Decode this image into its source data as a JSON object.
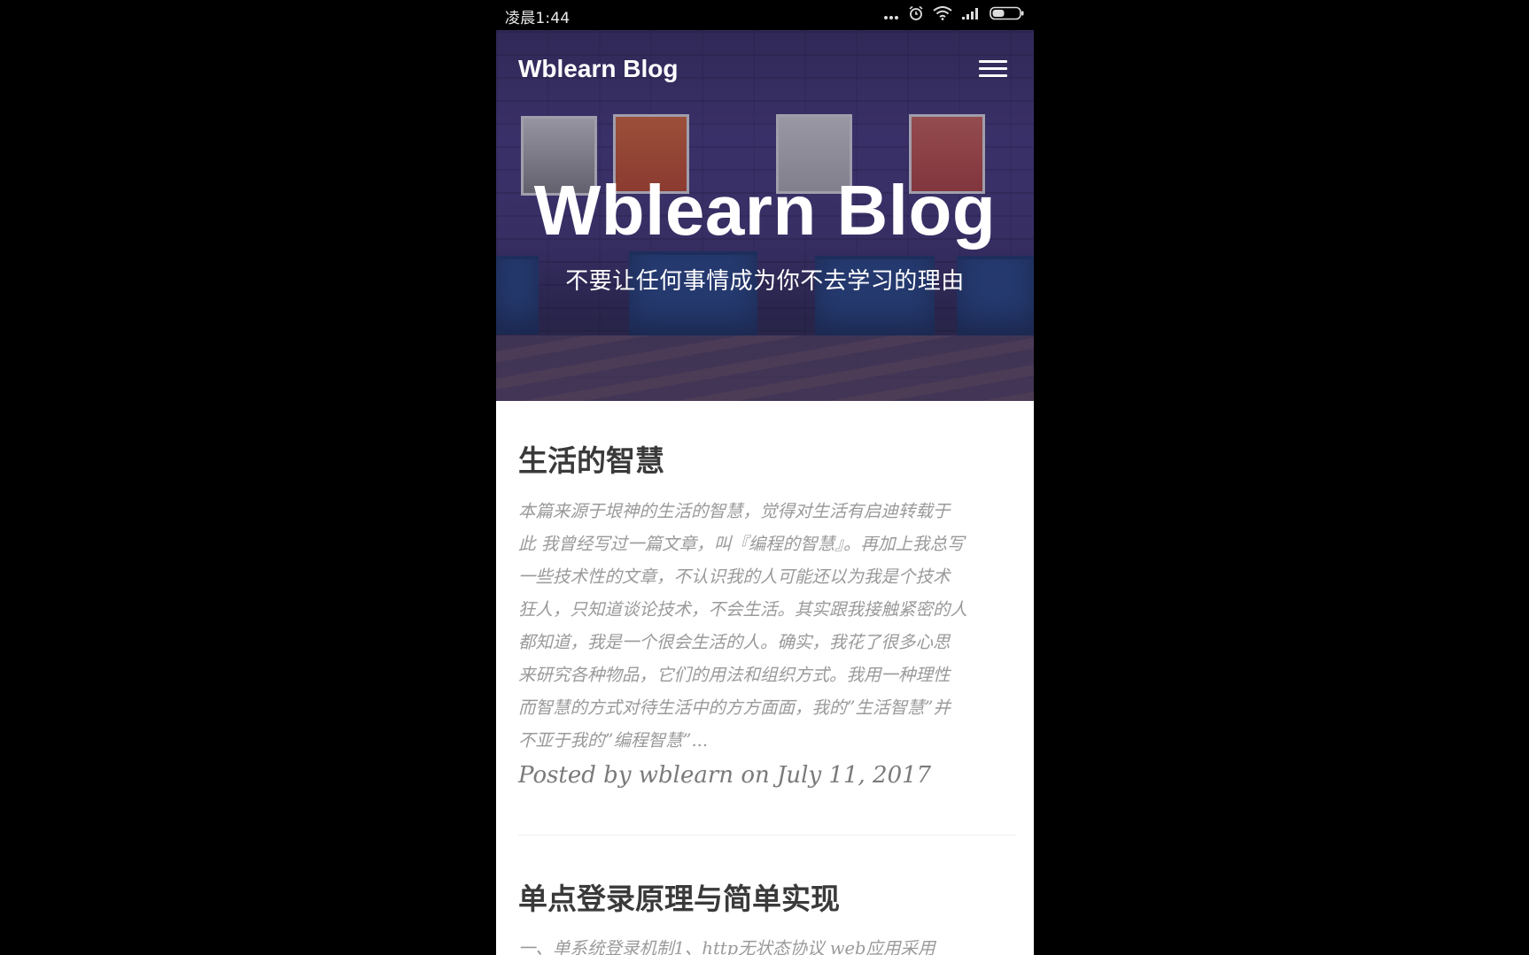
{
  "status_bar": {
    "time": "凌晨1:44",
    "icons": [
      "more-dots-icon",
      "alarm-icon",
      "wifi-icon",
      "signal-icon",
      "battery-icon"
    ]
  },
  "navbar": {
    "brand": "Wblearn Blog",
    "menu_icon": "hamburger-menu-icon"
  },
  "hero": {
    "title": "Wblearn Blog",
    "subtitle": "不要让任何事情成为你不去学习的理由"
  },
  "posts": [
    {
      "title": "生活的智慧",
      "excerpt_lines": [
        "本篇来源于垠神的生活的智慧，觉得对生活有启迪转载于",
        "此 我曾经写过一篇文章，叫『编程的智慧』。再加上我总写",
        "一些技术性的文章，不认识我的人可能还以为我是个技术",
        "狂人，只知道谈论技术，不会生活。其实跟我接触紧密的人",
        "都知道，我是一个很会生活的人。确实，我花了很多心思",
        "来研究各种物品，它们的用法和组织方式。我用一种理性",
        "而智慧的方式对待生活中的方方面面，我的”生活智慧”并",
        "不亚于我的”编程智慧”..."
      ],
      "meta": "Posted by wblearn on July 11, 2017"
    },
    {
      "title": "单点登录原理与简单实现",
      "excerpt_lines": [
        "一、单系统登录机制1、http无状态协议 web应用采用"
      ]
    }
  ],
  "colors": {
    "hero_overlay": "#4a4081",
    "post_title": "#3a3a3a",
    "excerpt": "#9a9a9a",
    "meta": "#7a7a7a"
  }
}
